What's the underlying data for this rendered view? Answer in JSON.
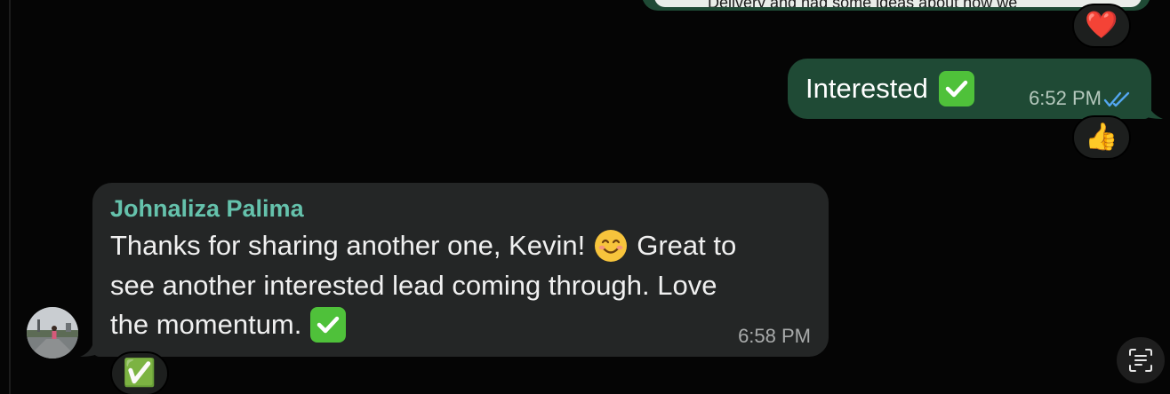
{
  "previous_message": {
    "quote_text": "Delivery and had some ideas about how we",
    "reaction": "❤️"
  },
  "outgoing_message": {
    "text": "Interested",
    "emoji": "check-mark-button",
    "time": "6:52 PM",
    "status": "read",
    "reaction": "👍"
  },
  "incoming_message": {
    "sender": "Johnaliza Palima",
    "lines": [
      "Thanks for sharing another one, Kevin!",
      "Great to",
      "see another interested lead coming through. Love",
      "the momentum."
    ],
    "time": "6:58 PM",
    "reaction": "✅"
  },
  "colors": {
    "background": "#050505",
    "outgoing_bubble": "#1f4a35",
    "incoming_bubble": "#242626",
    "sender_name": "#65c2ac",
    "read_ticks": "#53a6f0",
    "check_green": "#4fc13a"
  },
  "icons": {
    "read_receipt": "double-check-icon",
    "scan": "text-scan-icon",
    "avatar": "profile-photo"
  }
}
